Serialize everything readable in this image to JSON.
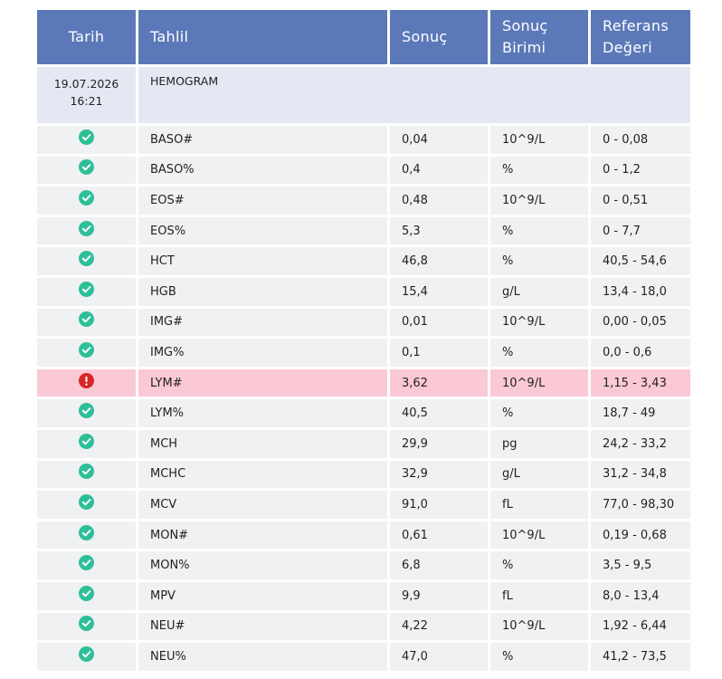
{
  "header": {
    "date": "Tarih",
    "test": "Tahlil",
    "result": "Sonuç",
    "unit_line1": "Sonuç",
    "unit_line2": "Birimi",
    "ref_line1": "Referans",
    "ref_line2": "Değeri"
  },
  "group": {
    "date": "19.07.2026",
    "time": "16:21",
    "name": "HEMOGRAM"
  },
  "colors": {
    "header_bg": "#5b79b9",
    "ok_icon": "#2fbf98",
    "alert_icon": "#d62626",
    "alert_row_bg": "#fbc9d6"
  },
  "rows": [
    {
      "status": "ok",
      "test": "BASO#",
      "result": "0,04",
      "unit": "10^9/L",
      "ref": "0 - 0,08"
    },
    {
      "status": "ok",
      "test": "BASO%",
      "result": "0,4",
      "unit": "%",
      "ref": "0 - 1,2"
    },
    {
      "status": "ok",
      "test": "EOS#",
      "result": "0,48",
      "unit": "10^9/L",
      "ref": "0 - 0,51"
    },
    {
      "status": "ok",
      "test": "EOS%",
      "result": "5,3",
      "unit": "%",
      "ref": "0 - 7,7"
    },
    {
      "status": "ok",
      "test": "HCT",
      "result": "46,8",
      "unit": "%",
      "ref": "40,5 - 54,6"
    },
    {
      "status": "ok",
      "test": "HGB",
      "result": "15,4",
      "unit": "g/L",
      "ref": "13,4 - 18,0"
    },
    {
      "status": "ok",
      "test": "IMG#",
      "result": "0,01",
      "unit": "10^9/L",
      "ref": "0,00 - 0,05"
    },
    {
      "status": "ok",
      "test": "IMG%",
      "result": "0,1",
      "unit": "%",
      "ref": "0,0 - 0,6"
    },
    {
      "status": "high",
      "test": "LYM#",
      "result": "3,62",
      "unit": "10^9/L",
      "ref": "1,15 - 3,43"
    },
    {
      "status": "ok",
      "test": "LYM%",
      "result": "40,5",
      "unit": "%",
      "ref": "18,7 - 49"
    },
    {
      "status": "ok",
      "test": "MCH",
      "result": "29,9",
      "unit": "pg",
      "ref": "24,2 - 33,2"
    },
    {
      "status": "ok",
      "test": "MCHC",
      "result": "32,9",
      "unit": "g/L",
      "ref": "31,2 - 34,8"
    },
    {
      "status": "ok",
      "test": "MCV",
      "result": "91,0",
      "unit": "fL",
      "ref": "77,0 - 98,30"
    },
    {
      "status": "ok",
      "test": "MON#",
      "result": "0,61",
      "unit": "10^9/L",
      "ref": "0,19 - 0,68"
    },
    {
      "status": "ok",
      "test": "MON%",
      "result": "6,8",
      "unit": "%",
      "ref": "3,5 - 9,5"
    },
    {
      "status": "ok",
      "test": "MPV",
      "result": "9,9",
      "unit": "fL",
      "ref": "8,0 - 13,4"
    },
    {
      "status": "ok",
      "test": "NEU#",
      "result": "4,22",
      "unit": "10^9/L",
      "ref": "1,92 - 6,44"
    },
    {
      "status": "ok",
      "test": "NEU%",
      "result": "47,0",
      "unit": "%",
      "ref": "41,2 - 73,5"
    }
  ]
}
